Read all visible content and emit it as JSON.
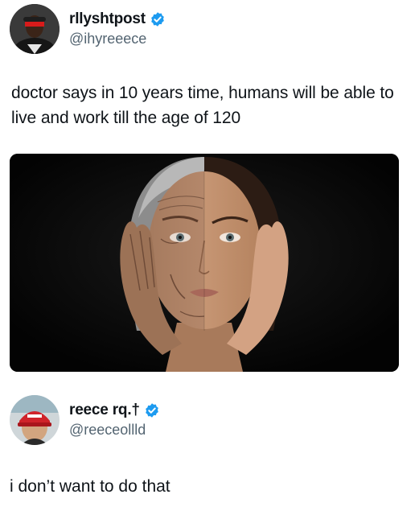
{
  "post": {
    "display_name": "rllyshtpost",
    "handle": "@ihyreeece",
    "verified_icon": "verified-badge-icon",
    "text": "doctor says in 10 years time, humans will be able to live and work till the age of 120",
    "media_alt_icon": "half-aged-face-photo"
  },
  "reply": {
    "display_name": "reece rq.†",
    "handle": "@reeceollld",
    "verified_icon": "verified-badge-icon",
    "text": "i don’t want to do that"
  },
  "colors": {
    "verified_blue": "#1d9bf0",
    "text_primary": "#0f1419",
    "text_secondary": "#536471"
  }
}
